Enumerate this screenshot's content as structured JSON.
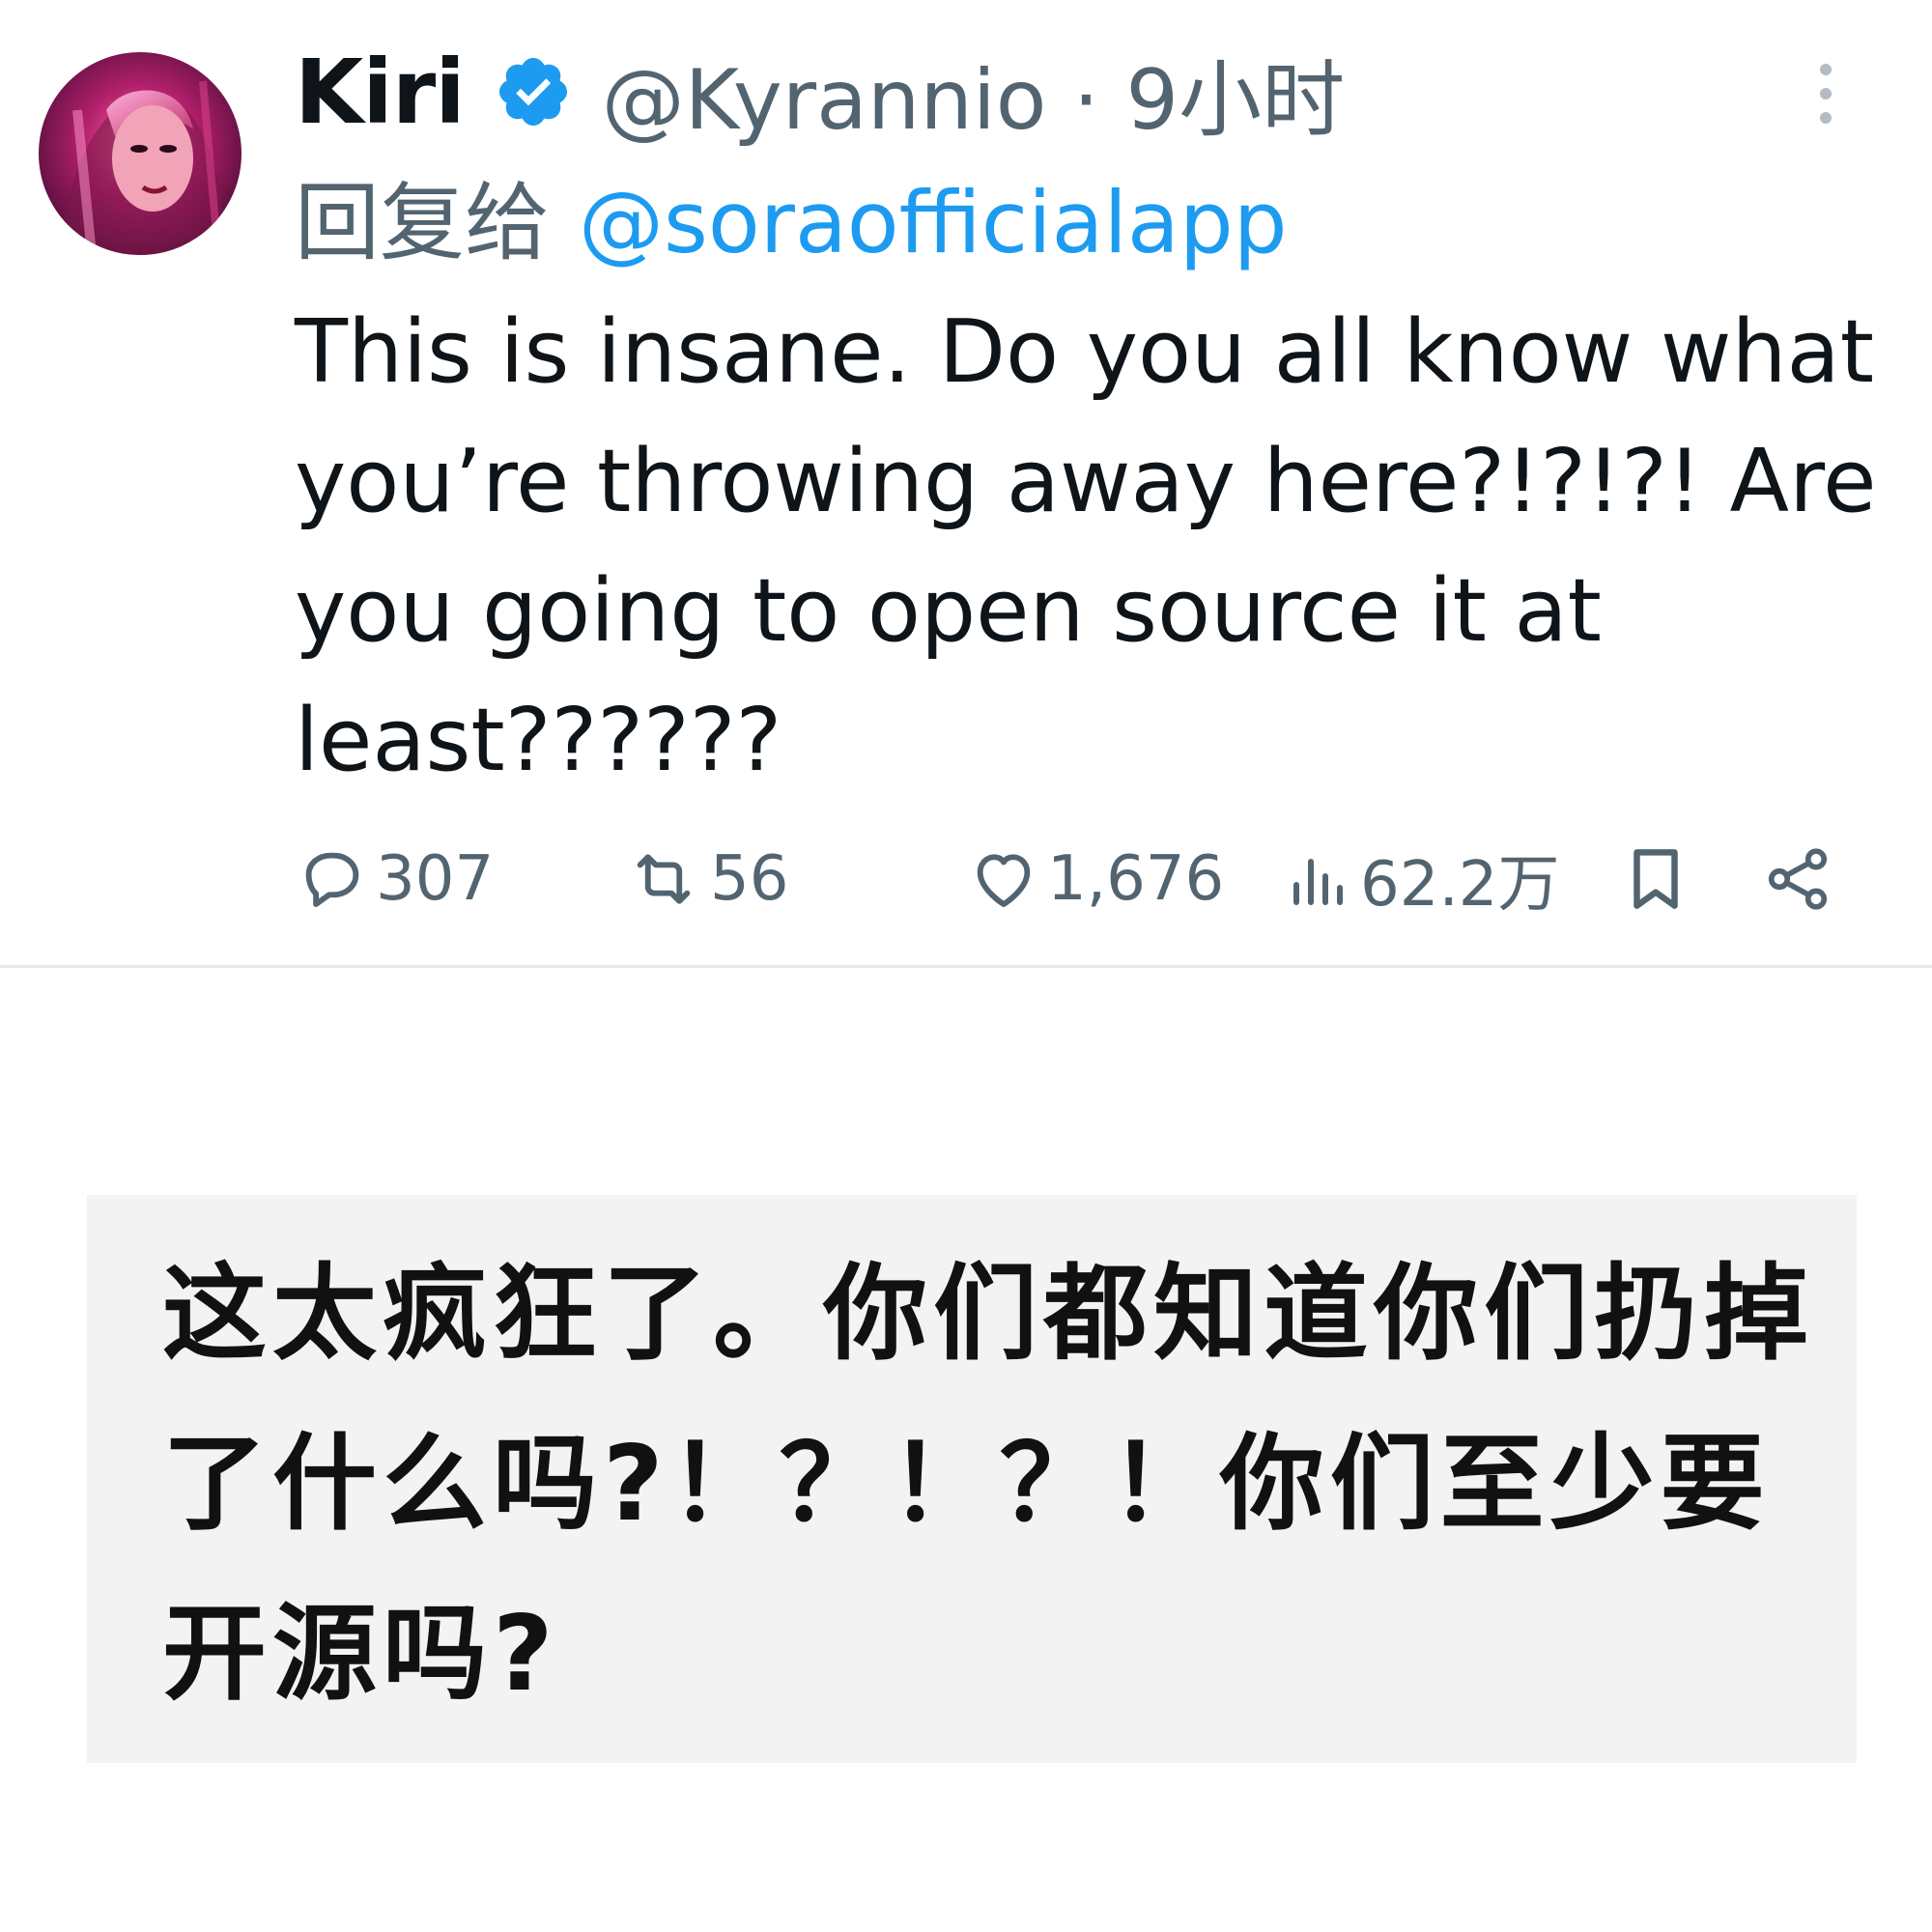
{
  "tweet": {
    "display_name": "Kiri",
    "handle": "@Kyrannio",
    "separator": "·",
    "time": "9小时",
    "reply_prefix": "回复给",
    "reply_to": "@soraofficialapp",
    "text": "This is insane. Do you all know what you’re throwing away here?!?!?! Are you going to open source it at least??????",
    "stats": {
      "replies": "307",
      "reposts": "56",
      "likes": "1,676",
      "views": "62.2万"
    }
  },
  "translation": {
    "text": "这太疯狂了。你们都知道你们扔掉了什么吗?！？！？！你们至少要开源吗?"
  },
  "icons": {
    "verified": "verified-badge-icon",
    "more": "more-vertical-icon",
    "reply": "reply-bubble-icon",
    "repost": "repost-arrows-icon",
    "like": "heart-icon",
    "views": "bar-chart-icon",
    "bookmark": "bookmark-icon",
    "share": "share-icon"
  },
  "colors": {
    "accent": "#1d9bf0",
    "secondary_text": "#536471",
    "translation_bg": "#f3f3f3"
  }
}
